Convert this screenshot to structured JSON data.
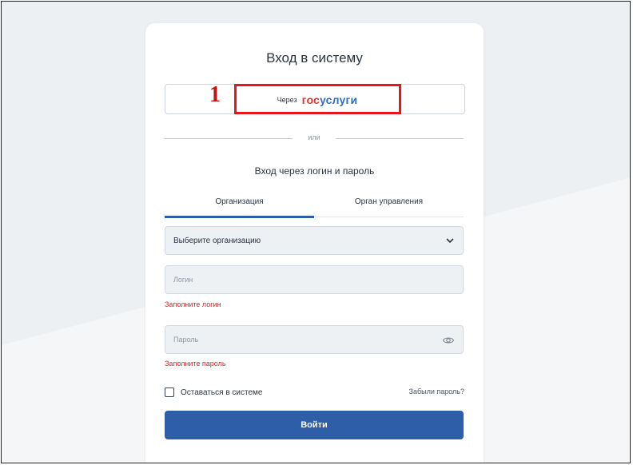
{
  "login": {
    "title": "Вход в систему",
    "gosuslugi": {
      "prefix": "Через",
      "logo_part1": "гос",
      "logo_part2": "услуги"
    },
    "annotation_number": "1",
    "divider_text": "или",
    "subtitle": "Вход через логин и пароль",
    "tabs": [
      {
        "label": "Организация",
        "active": true
      },
      {
        "label": "Орган управления",
        "active": false
      }
    ],
    "organization_select": {
      "value": "Выберите организацию"
    },
    "login_field": {
      "placeholder": "Логин",
      "value": "",
      "error": "Заполните логин"
    },
    "password_field": {
      "placeholder": "Пароль",
      "value": "",
      "error": "Заполните пароль"
    },
    "remember_label": "Оставаться в системе",
    "remember_checked": false,
    "forgot_link": "Забыли пароль?",
    "submit_label": "Войти"
  },
  "colors": {
    "primary": "#2f5ea8",
    "error": "#d12b2b",
    "highlight": "#e8161a",
    "gos_red": "#e0342c",
    "gos_blue": "#2c6fc2"
  }
}
